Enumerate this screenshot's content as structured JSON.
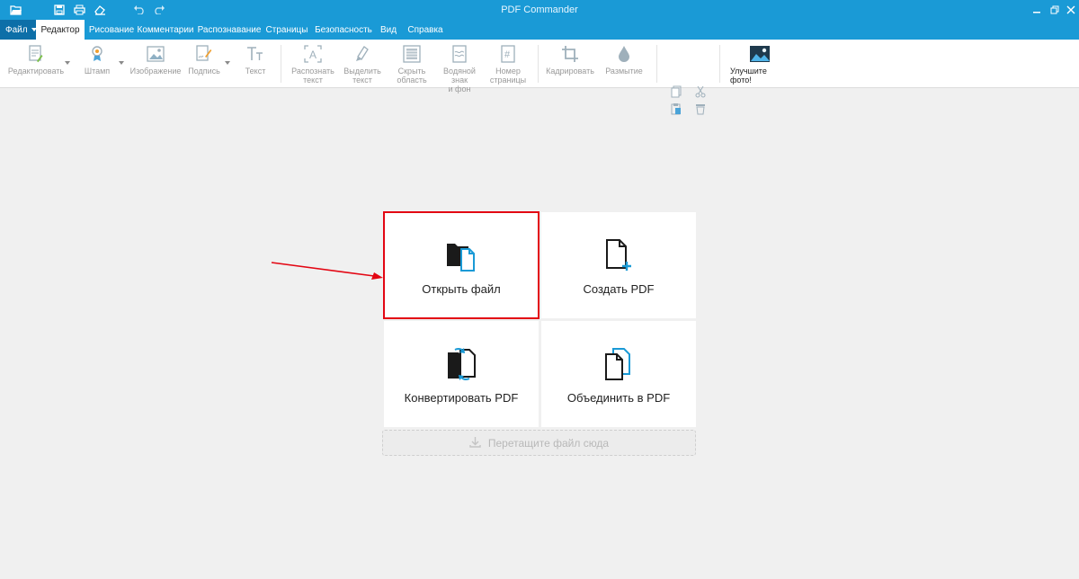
{
  "window": {
    "title": "PDF Commander"
  },
  "quick_access": [
    "open-folder-icon",
    "save-icon",
    "print-icon",
    "erase-icon",
    "undo-icon",
    "redo-icon"
  ],
  "menu": {
    "file_label": "Файл",
    "tabs": [
      "Редактор",
      "Рисование",
      "Комментарии",
      "Распознавание",
      "Страницы",
      "Безопасность",
      "Вид",
      "Справка"
    ],
    "active_tab": "Редактор"
  },
  "ribbon": {
    "edit": "Редактировать",
    "stamp": "Штамп",
    "image": "Изображение",
    "sign": "Подпись",
    "text": "Текст",
    "recognize": "Распознать\nтекст",
    "select_text": "Выделить\nтекст",
    "hide_area": "Скрыть\nобласть",
    "watermark": "Водяной знак\nи фон",
    "page_number": "Номер\nстраницы",
    "crop": "Кадрировать",
    "blur": "Размытие",
    "enhance": "Улучшите фото!"
  },
  "tiles": {
    "open": "Открыть файл",
    "create": "Создать PDF",
    "convert": "Конвертировать PDF",
    "merge": "Объединить в PDF"
  },
  "dropzone": {
    "label": "Перетащите файл сюда"
  },
  "colors": {
    "accent": "#1a9ad6",
    "highlight": "#e30613",
    "icon_blue": "#1a9ad6"
  }
}
